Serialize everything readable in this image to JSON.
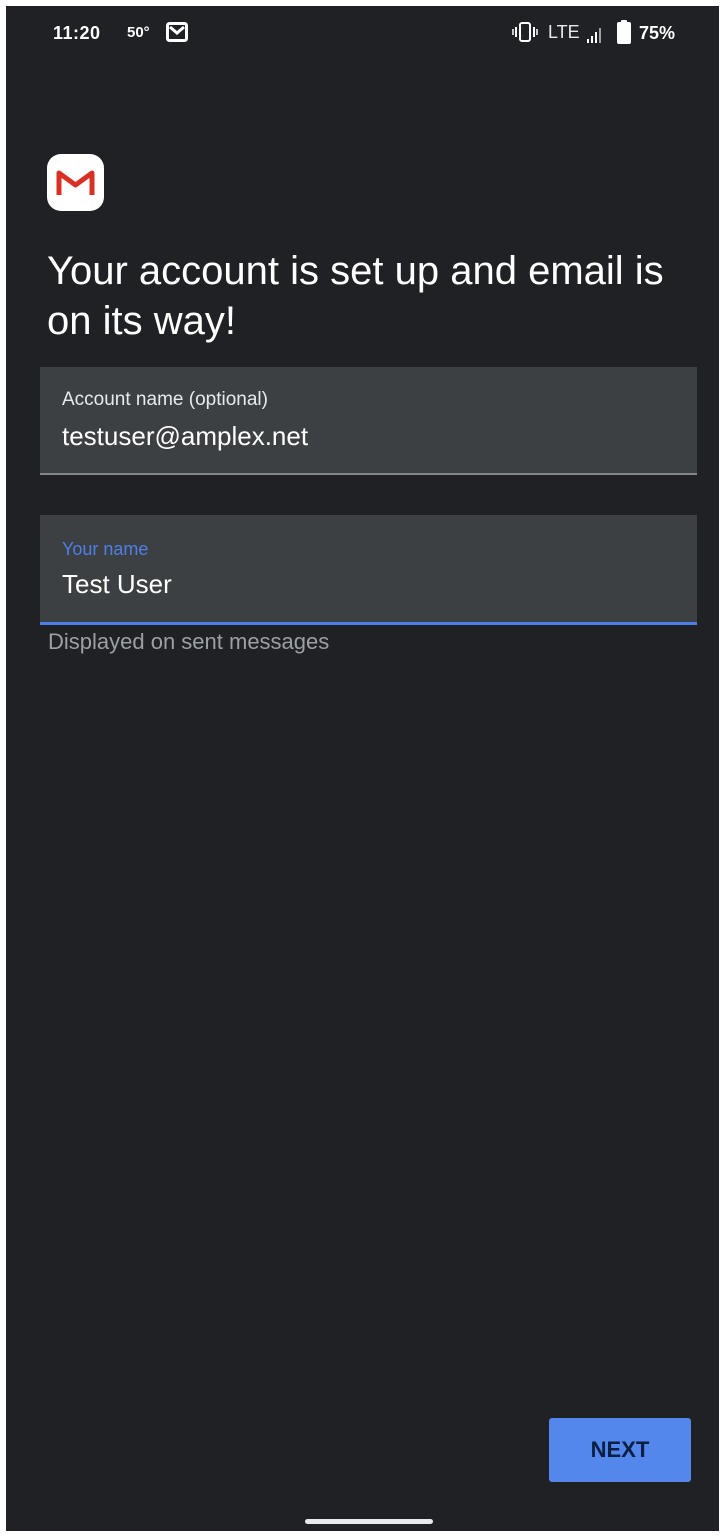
{
  "status_bar": {
    "time": "11:20",
    "temperature": "50°",
    "network": "LTE",
    "battery": "75%",
    "icons": [
      "gmail-notification-icon",
      "vibrate-icon",
      "signal-icon",
      "battery-icon"
    ]
  },
  "app": {
    "logo_icon": "gmail-logo-icon"
  },
  "page": {
    "title": "Your account is set up and email is on its way!"
  },
  "form": {
    "account_name": {
      "label": "Account name (optional)",
      "value": "testuser@amplex.net"
    },
    "your_name": {
      "label": "Your name",
      "value": "Test User",
      "helper": "Displayed on sent messages"
    }
  },
  "actions": {
    "next_label": "NEXT"
  },
  "colors": {
    "background": "#202124",
    "field_background": "#3c4043",
    "accent": "#4f7ee8",
    "button": "#5387ec"
  }
}
